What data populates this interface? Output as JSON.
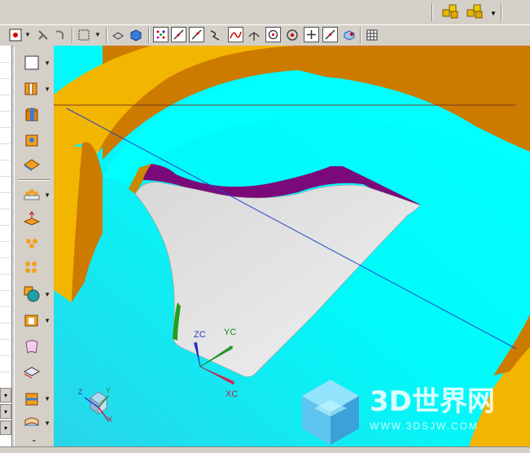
{
  "toolbar": {
    "top_right_icons": [
      "assembly-icon",
      "assembly-add-icon"
    ],
    "row2_icons": [
      "snap-point-icon",
      "measure-icon",
      "drag-icon",
      "select-box-icon",
      "view-orient-icon",
      "render-icon",
      "point-set-icon",
      "line-icon",
      "line-alt-icon",
      "curve-icon",
      "spline-icon",
      "intersect-icon",
      "circle-icon",
      "tangent-icon",
      "plus-icon",
      "slash-icon",
      "fit-icon",
      "grid-icon"
    ]
  },
  "side_toolbar": {
    "icons": [
      "sketch-icon",
      "extrude-icon",
      "cylinder-icon",
      "block-icon",
      "feature-icon",
      "pattern-icon",
      "offset-icon",
      "array-icon",
      "hole-array-icon",
      "boolean-icon",
      "shell-icon",
      "surface-icon",
      "thicken-icon",
      "sew-icon",
      "more-icon"
    ]
  },
  "viewport": {
    "labels": {
      "zc": "ZC",
      "yc": "YC",
      "xc": "XC"
    },
    "triad_labels": {
      "z": "Z",
      "y": "Y",
      "x": "X"
    },
    "watermark": {
      "main": "3D世界网",
      "url": "WWW.3DSJW.COM"
    },
    "colors": {
      "background_cyan": "#00ffff",
      "ring_orange": "#f2b600",
      "ring_dark": "#cc7a00",
      "surface_gray": "#e3e3e3",
      "wall_purple": "#7a0a7a",
      "axis_blue": "#2244cc"
    }
  }
}
